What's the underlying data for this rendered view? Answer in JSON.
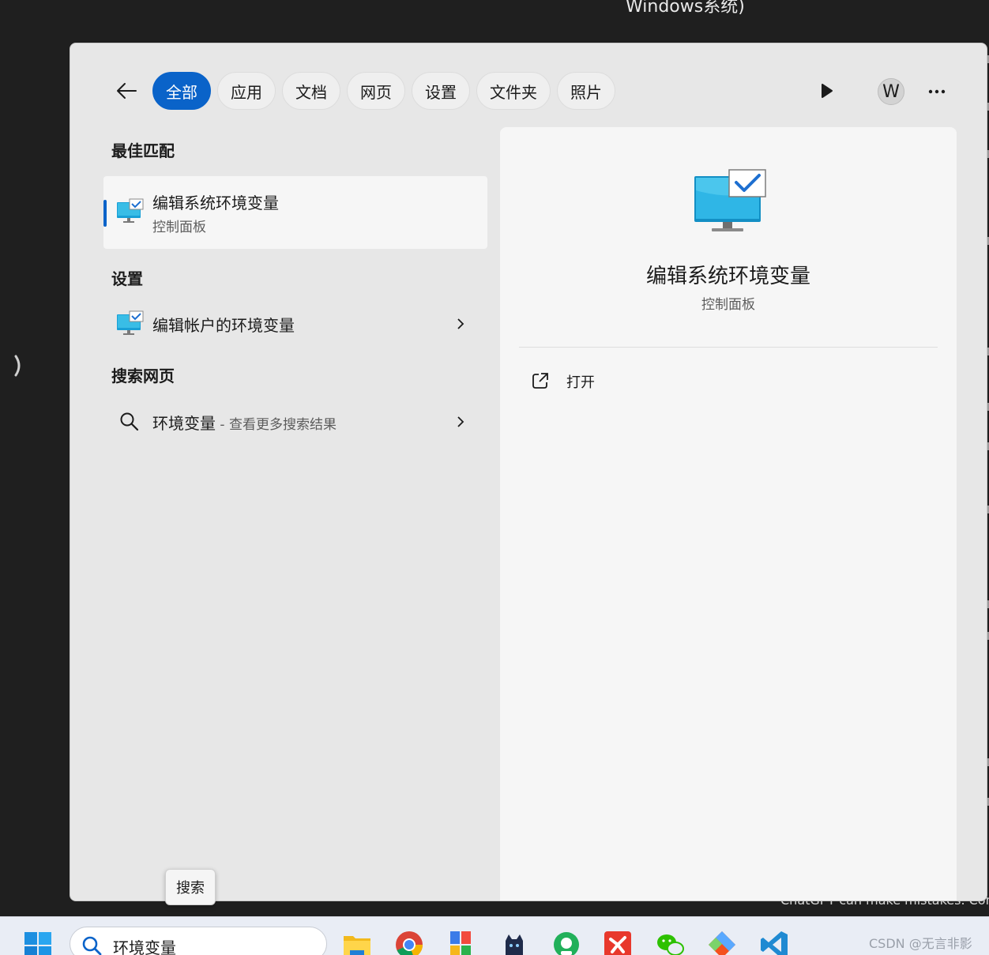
{
  "background": {
    "window_title": "Windows系统)",
    "footer_text": "ChatGPT can make mistakes. Con"
  },
  "filters": {
    "back_label": "",
    "chips": [
      {
        "label": "全部",
        "active": true
      },
      {
        "label": "应用",
        "active": false
      },
      {
        "label": "文档",
        "active": false
      },
      {
        "label": "网页",
        "active": false
      },
      {
        "label": "设置",
        "active": false
      },
      {
        "label": "文件夹",
        "active": false
      },
      {
        "label": "照片",
        "active": false
      }
    ],
    "avatar_letter": "W",
    "accent_color": "#0a63c9"
  },
  "results": {
    "best_match_heading": "最佳匹配",
    "best_match": {
      "title": "编辑系统环境变量",
      "subtitle": "控制面板",
      "icon": "monitor-check-icon"
    },
    "settings_heading": "设置",
    "settings_item": {
      "title": "编辑帐户的环境变量",
      "icon": "monitor-check-icon"
    },
    "web_heading": "搜索网页",
    "web_item": {
      "query": "环境变量",
      "hint": " - 查看更多搜索结果",
      "icon": "search-icon"
    }
  },
  "preview": {
    "title": "编辑系统环境变量",
    "subtitle": "控制面板",
    "open_label": "打开",
    "icon": "monitor-check-icon"
  },
  "tooltip": {
    "label": "搜索"
  },
  "taskbar": {
    "search_value": "环境变量",
    "apps": [
      "file-explorer-icon",
      "chrome-icon",
      "store-icon",
      "cat-app-icon",
      "green-app-icon",
      "red-app-icon",
      "wechat-icon",
      "git-app-icon",
      "vscode-icon"
    ],
    "watermark": "CSDN @无言非影"
  }
}
